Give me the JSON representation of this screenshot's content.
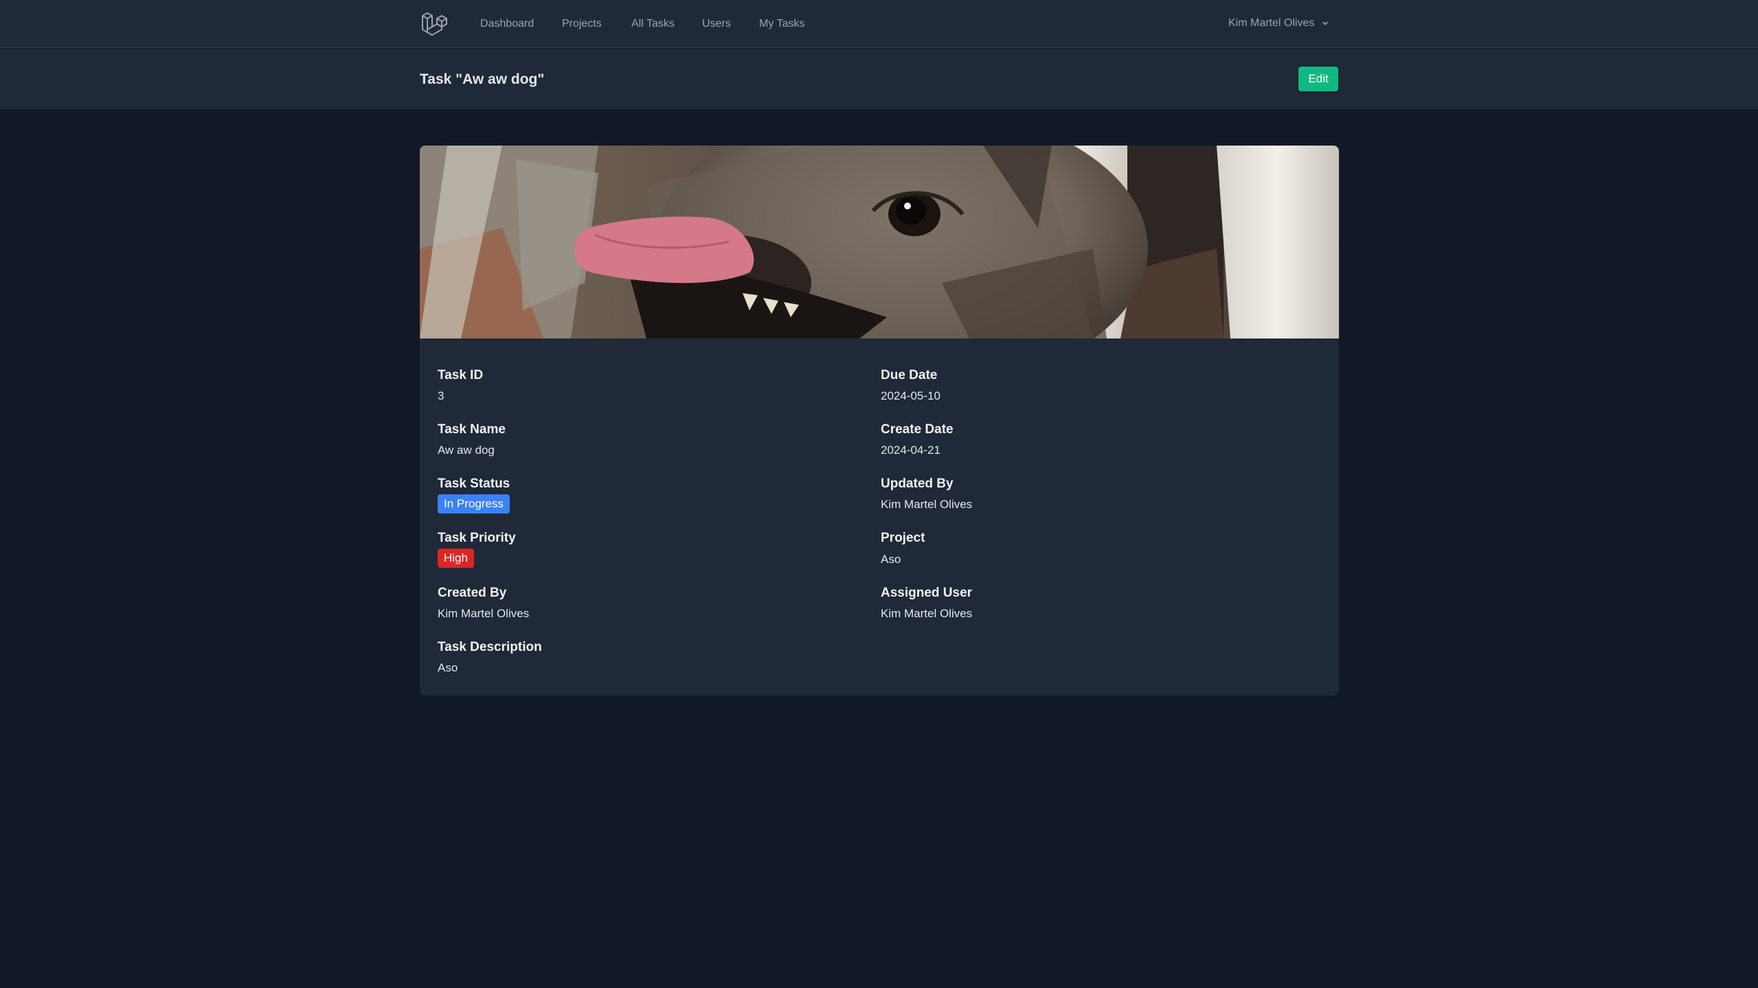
{
  "nav": {
    "links": [
      "Dashboard",
      "Projects",
      "All Tasks",
      "Users",
      "My Tasks"
    ],
    "user_name": "Kim Martel Olives"
  },
  "header": {
    "title": "Task \"Aw aw dog\"",
    "edit_label": "Edit"
  },
  "task": {
    "left_fields": [
      {
        "label": "Task ID",
        "value": "3"
      },
      {
        "label": "Task Name",
        "value": "Aw aw dog"
      },
      {
        "label": "Task Status",
        "value": "In Progress"
      },
      {
        "label": "Task Priority",
        "value": "High"
      },
      {
        "label": "Created By",
        "value": "Kim Martel Olives"
      },
      {
        "label": "Task Description",
        "value": "Aso"
      }
    ],
    "right_fields": [
      {
        "label": "Due Date",
        "value": "2024-05-10"
      },
      {
        "label": "Create Date",
        "value": "2024-04-21"
      },
      {
        "label": "Updated By",
        "value": "Kim Martel Olives"
      },
      {
        "label": "Project",
        "value": "Aso"
      },
      {
        "label": "Assigned User",
        "value": "Kim Martel Olives"
      }
    ]
  },
  "colors": {
    "status_in_progress": "#3b82f6",
    "priority_high": "#dc2626",
    "edit_button": "#10b981"
  },
  "icons": {
    "logo": "laravel-logo-icon",
    "dropdown": "chevron-down-icon"
  }
}
